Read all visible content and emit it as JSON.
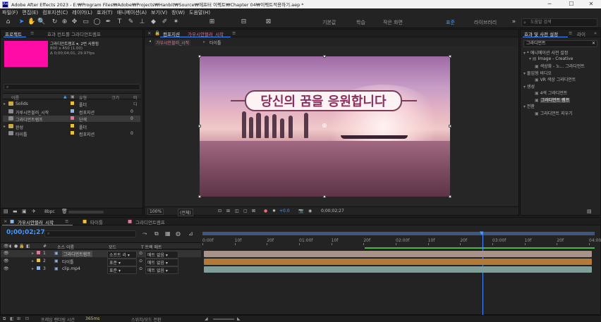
{
  "window": {
    "title": "Adobe After Effects 2023 - E:₩Program Files₩Adobe₩Projects₩Hanbit₩Source₩에프터 이펙트₩Chapter 04₩이펙트적용하기.aep *",
    "minimize": "─",
    "maximize": "☐",
    "close": "✕"
  },
  "menu": [
    "파일(F)",
    "편집(E)",
    "컴포지션(C)",
    "레이어(L)",
    "효과(T)",
    "애니메이션(A)",
    "보기(V)",
    "창(W)",
    "도움말(H)"
  ],
  "workspaces": [
    {
      "label": "기본값"
    },
    {
      "label": "학습"
    },
    {
      "label": "작은 화면"
    },
    {
      "label": "표준"
    },
    {
      "label": "라이브러리"
    }
  ],
  "workspaces_main": [
    "기본값",
    "학습",
    "작은 화면",
    "표준",
    "라이브러리"
  ],
  "ws_active": "표준",
  "help_search": {
    "placeholder": "도움말 검색"
  },
  "project": {
    "tab": "프로젝트",
    "tab2": "효과 컨트롤 그라디언트램프",
    "selected_name": "그라디언트램프 ▾, 2번 사용됨",
    "selected_size": "800 x 450 (1.00)",
    "selected_dur": "Δ 0;00;04;01, 29.97fps",
    "search_placeholder": "",
    "columns": [
      "이름",
      "유형",
      "크기",
      "미디"
    ],
    "items": [
      {
        "name": "Solids",
        "type": "폴더",
        "color": "#e8c23a",
        "size": ""
      },
      {
        "name": "가루시안블러_시작",
        "type": "컴포지션",
        "color": "#8fb4e0",
        "size": "0"
      },
      {
        "name": "그라디언트램프",
        "type": "단색",
        "color": "#d77a9c",
        "size": "0"
      },
      {
        "name": "완성",
        "type": "폴더",
        "color": "#e8c23a",
        "size": ""
      },
      {
        "name": "타이틀",
        "type": "컴포지션",
        "color": "#e8c23a",
        "size": "0"
      }
    ],
    "bpc": "8bpc"
  },
  "comp": {
    "tab": "컴포지션",
    "tab_name": "가우시안블러_시작",
    "subtabs": [
      "가우시안블러_시작",
      "타이틀"
    ],
    "title_text": "당신의 꿈을 응원합니다",
    "zoom": "100%",
    "resolution": "(전체)",
    "exposure": "+0.0",
    "timecode": "0;00;02;27"
  },
  "effects": {
    "tab": "효과 및 사전 설정",
    "tab2": "라이",
    "search": "그라디언트",
    "tree": [
      {
        "label": "* 애니메이션 사전 설정",
        "indent": 0
      },
      {
        "label": "Image - Creative",
        "indent": 1
      },
      {
        "label": "색상화 - 노... 그라디언트",
        "indent": 2
      },
      {
        "label": "몰입형 비디오",
        "indent": 0
      },
      {
        "label": "VR 색상 그라디언트",
        "indent": 2
      },
      {
        "label": "생성",
        "indent": 0
      },
      {
        "label": "4색 그라디언트",
        "indent": 2
      },
      {
        "label": "그라디언트 램프",
        "indent": 2,
        "selected": true
      },
      {
        "label": "전환",
        "indent": 0
      },
      {
        "label": "그라디언트 지우기",
        "indent": 2
      }
    ]
  },
  "timeline": {
    "tabs": [
      "가우시안블러_시작",
      "타이틀",
      "그라디언트램프"
    ],
    "current_time": "0;00;02;27",
    "col_headers": {
      "num": "#",
      "source": "소스 이름",
      "mode": "모드",
      "trkmat": "T 트랙 매트"
    },
    "layers": [
      {
        "num": "1",
        "name": "그라디언트램프",
        "mode": "소프트 라",
        "matte": "매트 없음",
        "label": "#d77a9c",
        "bar": "#a7938a"
      },
      {
        "num": "2",
        "name": "타이틀",
        "mode": "표준",
        "matte": "매트 없음",
        "label": "#e8c23a",
        "bar": "#b37a37"
      },
      {
        "num": "3",
        "name": "clip.mp4",
        "mode": "표준",
        "matte": "매트 없음",
        "label": "#8fb4e0",
        "bar": "#7f9e9a"
      }
    ],
    "ruler": [
      "0:00f",
      "10f",
      "20f",
      "01:00f",
      "10f",
      "20f",
      "02:00f",
      "10f",
      "20f",
      "03:00f",
      "10f",
      "20f",
      "04:00"
    ],
    "status_left": "프레임 렌더링 시간",
    "status_value": "365ms",
    "status_right": "스위치/모드 전환"
  }
}
